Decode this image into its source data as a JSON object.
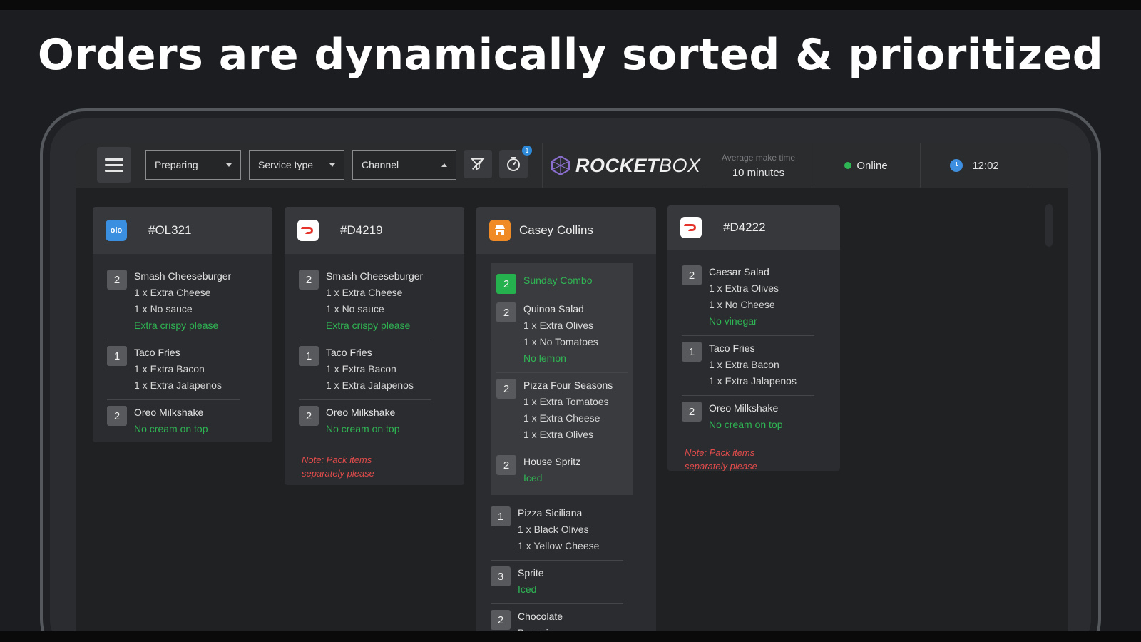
{
  "headline": "Orders are dynamically sorted & prioritized",
  "toolbar": {
    "status_filter": "Preparing",
    "service_filter": "Service type",
    "channel_filter": "Channel",
    "notification_count": "1"
  },
  "brand": {
    "bold": "ROCKET",
    "light": "BOX"
  },
  "stats": {
    "avg_label": "Average make time",
    "avg_value": "10 minutes",
    "status": "Online",
    "clock": "12:02"
  },
  "colors": {
    "online": "#2fb654",
    "note_red": "#e24c4c",
    "olo_blue": "#3b8fe0",
    "doordash_red": "#e5342b",
    "orange": "#f08a24"
  },
  "orders": [
    {
      "title": "#OL321",
      "source_icon": "olo-icon",
      "items": [
        {
          "qty": "2",
          "name": "Smash Cheeseburger",
          "mods": [
            "1 x Extra Cheese",
            "1 x No sauce"
          ],
          "note": "Extra crispy please"
        },
        {
          "qty": "1",
          "name": "Taco Fries",
          "mods": [
            "1 x Extra Bacon",
            "1 x Extra Jalapenos"
          ],
          "note": ""
        },
        {
          "qty": "2",
          "name": "Oreo Milkshake",
          "mods": [],
          "note": "No cream on top"
        }
      ],
      "order_note": ""
    },
    {
      "title": "#D4219",
      "source_icon": "doordash-icon",
      "items": [
        {
          "qty": "2",
          "name": "Smash Cheeseburger",
          "mods": [
            "1 x Extra Cheese",
            "1 x No sauce"
          ],
          "note": "Extra crispy please"
        },
        {
          "qty": "1",
          "name": "Taco Fries",
          "mods": [
            "1 x Extra Bacon",
            "1 x Extra Jalapenos"
          ],
          "note": ""
        },
        {
          "qty": "2",
          "name": "Oreo Milkshake",
          "mods": [],
          "note": "No cream on top"
        }
      ],
      "order_note": "Note: Pack items separately please"
    },
    {
      "title": "Casey Collins",
      "source_icon": "store-icon",
      "combo": {
        "qty": "2",
        "name": "Sunday Combo",
        "items": [
          {
            "qty": "2",
            "name": "Quinoa Salad",
            "mods": [
              "1 x Extra Olives",
              "1 x No Tomatoes"
            ],
            "note": "No lemon"
          },
          {
            "qty": "2",
            "name": "Pizza Four Seasons",
            "mods": [
              "1 x Extra Tomatoes",
              "1 x Extra Cheese",
              "1 x Extra Olives"
            ],
            "note": ""
          },
          {
            "qty": "2",
            "name": "House Spritz",
            "mods": [],
            "note": "Iced"
          }
        ]
      },
      "items": [
        {
          "qty": "1",
          "name": "Pizza Siciliana",
          "mods": [
            "1 x Black Olives",
            "1 x Yellow Cheese"
          ],
          "note": ""
        },
        {
          "qty": "3",
          "name": "Sprite",
          "mods": [],
          "note": "Iced"
        },
        {
          "qty": "2",
          "name": "Chocolate",
          "mods": [
            "Brownie"
          ],
          "note": ""
        }
      ]
    },
    {
      "title": "#D4222",
      "source_icon": "doordash-icon",
      "items": [
        {
          "qty": "2",
          "name": "Caesar Salad",
          "mods": [
            "1 x Extra Olives",
            "1 x No Cheese"
          ],
          "note": "No vinegar"
        },
        {
          "qty": "1",
          "name": "Taco Fries",
          "mods": [
            "1 x Extra Bacon",
            "1 x Extra Jalapenos"
          ],
          "note": ""
        },
        {
          "qty": "2",
          "name": "Oreo Milkshake",
          "mods": [],
          "note": "No cream on top"
        }
      ],
      "order_note": "Note: Pack items separately please"
    }
  ]
}
